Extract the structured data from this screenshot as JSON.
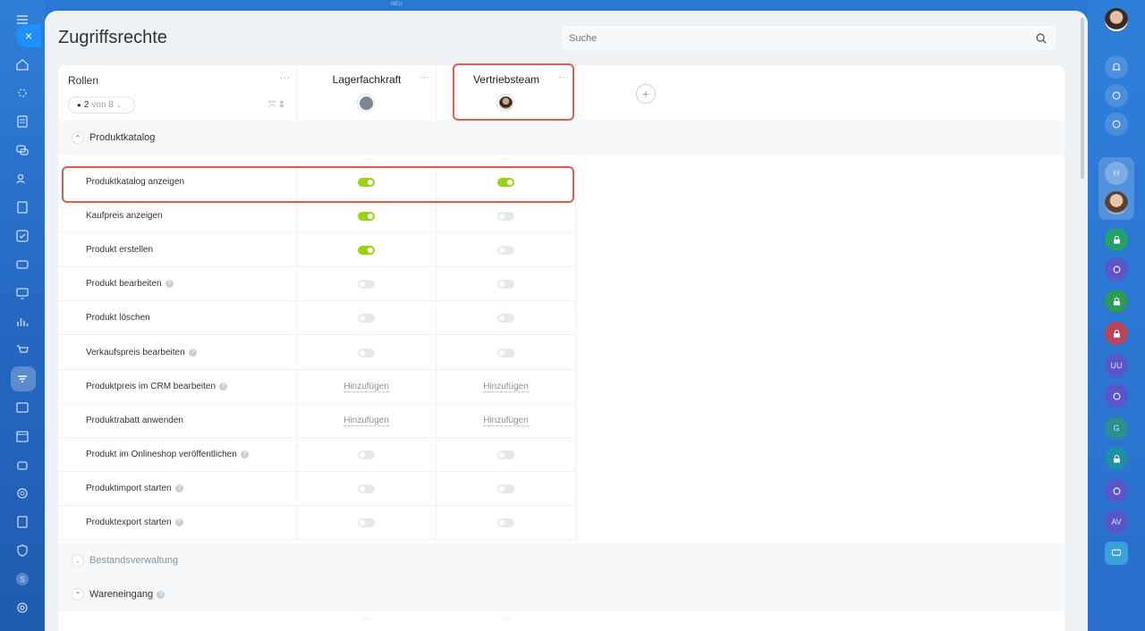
{
  "left_rail": {
    "close_label": "×",
    "icons": [
      "menu-icon",
      "home-icon",
      "sparkle-icon",
      "feed-icon",
      "chat-icon",
      "contacts-icon",
      "document-icon",
      "tasks-icon",
      "card-icon",
      "monitor-icon",
      "analytics-icon",
      "cart-icon",
      "filter-icon",
      "news-icon",
      "calendar-icon",
      "robot-icon",
      "target-icon",
      "signature-icon",
      "shield-icon",
      "settings-icon"
    ],
    "user_badge": "S"
  },
  "top_strip_label": "NEU",
  "page": {
    "title": "Zugriffsrechte",
    "search_placeholder": "Suche"
  },
  "header": {
    "roles_title": "Rollen",
    "role_count": "2",
    "role_of": "von 8",
    "dots": "···",
    "columns": [
      {
        "name": "Lagerfachkraft",
        "avatar": "default-user-avatar"
      },
      {
        "name": "Vertriebsteam",
        "avatar": "photo-avatar"
      }
    ],
    "add_column": "+"
  },
  "sections": [
    {
      "name": "Produktkatalog",
      "expanded": true
    },
    {
      "name": "Bestandsverwaltung",
      "expanded": false
    },
    {
      "name": "Wareneingang",
      "expanded": true
    }
  ],
  "rows": [
    {
      "label": "Produktkatalog anzeigen",
      "help": false,
      "values": [
        "on",
        "on"
      ]
    },
    {
      "label": "Kaufpreis anzeigen",
      "help": false,
      "values": [
        "on",
        "off"
      ]
    },
    {
      "label": "Produkt erstellen",
      "help": false,
      "values": [
        "on",
        "off"
      ]
    },
    {
      "label": "Produkt bearbeiten",
      "help": true,
      "values": [
        "off",
        "off"
      ]
    },
    {
      "label": "Produkt löschen",
      "help": false,
      "values": [
        "off",
        "off"
      ]
    },
    {
      "label": "Verkaufspreis bearbeiten",
      "help": true,
      "values": [
        "off",
        "off"
      ]
    },
    {
      "label": "Produktpreis im CRM bearbeiten",
      "help": true,
      "values": [
        "add",
        "add"
      ]
    },
    {
      "label": "Produktrabatt anwenden",
      "help": false,
      "values": [
        "add",
        "add"
      ]
    },
    {
      "label": "Produkt im Onlineshop veröffentlichen",
      "help": true,
      "values": [
        "off",
        "off"
      ]
    },
    {
      "label": "Produktimport starten",
      "help": true,
      "values": [
        "off",
        "off"
      ]
    },
    {
      "label": "Produktexport starten",
      "help": true,
      "values": [
        "off",
        "off"
      ]
    }
  ],
  "add_label": "Hinzufügen",
  "right_rail": {
    "items": [
      "bell-icon",
      "target-icon",
      "chat-icon",
      "H",
      "user-avatar",
      "lock-icon",
      "target-icon",
      "lock-icon",
      "lock-icon",
      "UU",
      "target-icon",
      "G",
      "lock-icon",
      "target-icon",
      "AV",
      "chat-icon"
    ]
  },
  "colors": {
    "accent": "#2a78d6",
    "toggle_on": "#9ad315",
    "highlight": "#e05a52"
  }
}
